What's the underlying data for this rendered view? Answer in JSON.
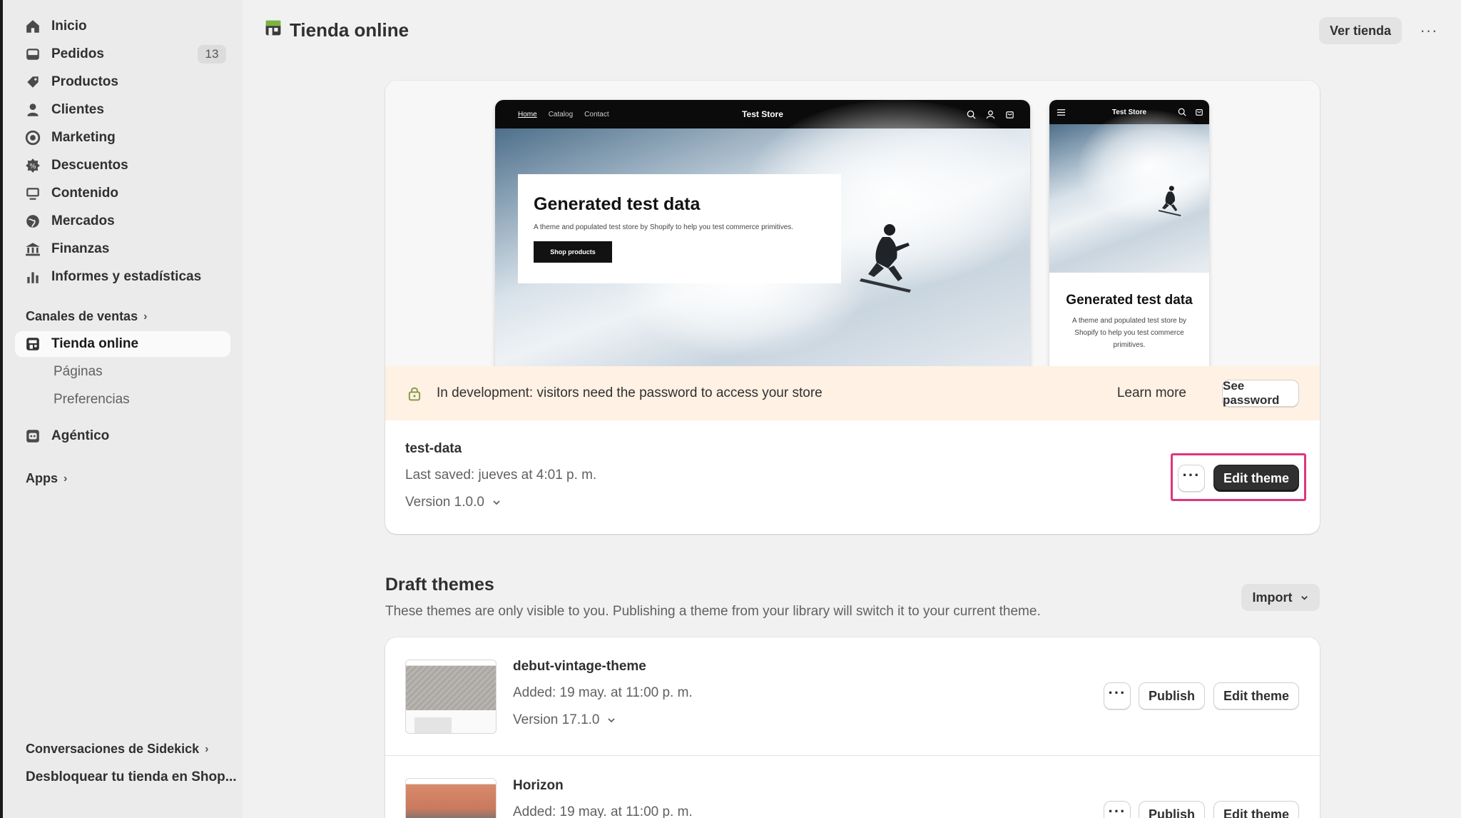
{
  "sidebar": {
    "nav": [
      {
        "label": "Inicio",
        "icon": "home-icon"
      },
      {
        "label": "Pedidos",
        "icon": "orders-icon",
        "badge": "13"
      },
      {
        "label": "Productos",
        "icon": "tag-icon"
      },
      {
        "label": "Clientes",
        "icon": "person-icon"
      },
      {
        "label": "Marketing",
        "icon": "target-icon"
      },
      {
        "label": "Descuentos",
        "icon": "discount-icon"
      },
      {
        "label": "Contenido",
        "icon": "content-icon"
      },
      {
        "label": "Mercados",
        "icon": "globe-icon"
      },
      {
        "label": "Finanzas",
        "icon": "bank-icon"
      },
      {
        "label": "Informes y estadísticas",
        "icon": "bar-chart-icon"
      }
    ],
    "sales_channels_label": "Canales de ventas",
    "online_store_label": "Tienda online",
    "sub_items": [
      "Páginas",
      "Preferencias"
    ],
    "agentic_label": "Agéntico",
    "apps_label": "Apps",
    "sidekick_label": "Conversaciones de Sidekick",
    "unlock_label": "Desbloquear tu tienda en Shop..."
  },
  "header": {
    "title": "Tienda online",
    "view_store": "Ver tienda",
    "more": "···"
  },
  "preview": {
    "nav_links": [
      "Home",
      "Catalog",
      "Contact"
    ],
    "store_name": "Test Store",
    "hero_title": "Generated test data",
    "hero_text": "A theme and populated test store by Shopify to help you test commerce primitives.",
    "hero_cta": "Shop products",
    "mobile_title": "Generated test data",
    "mobile_text": "A theme and populated test store by Shopify to help you test commerce primitives."
  },
  "banner": {
    "message": "In development: visitors need the password to access your store",
    "learn_more": "Learn more",
    "see_password": "See password"
  },
  "current_theme": {
    "name": "test-data",
    "last_saved": "Last saved: jueves at 4:01 p. m.",
    "version": "Version 1.0.0",
    "edit": "Edit theme",
    "more": "···"
  },
  "drafts": {
    "title": "Draft themes",
    "description": "These themes are only visible to you. Publishing a theme from your library will switch it to your current theme.",
    "import": "Import",
    "themes": [
      {
        "name": "debut-vintage-theme",
        "added": "Added: 19 may. at 11:00 p. m.",
        "version": "Version 17.1.0",
        "publish": "Publish",
        "edit": "Edit theme",
        "more": "···"
      },
      {
        "name": "Horizon",
        "added": "Added: 19 may. at 11:00 p. m.",
        "publish": "Publish",
        "edit": "Edit theme",
        "more": "···"
      }
    ]
  },
  "colors": {
    "accent_highlight": "#e0347e",
    "banner_bg": "#fff1e3",
    "primary_button": "#303030"
  }
}
